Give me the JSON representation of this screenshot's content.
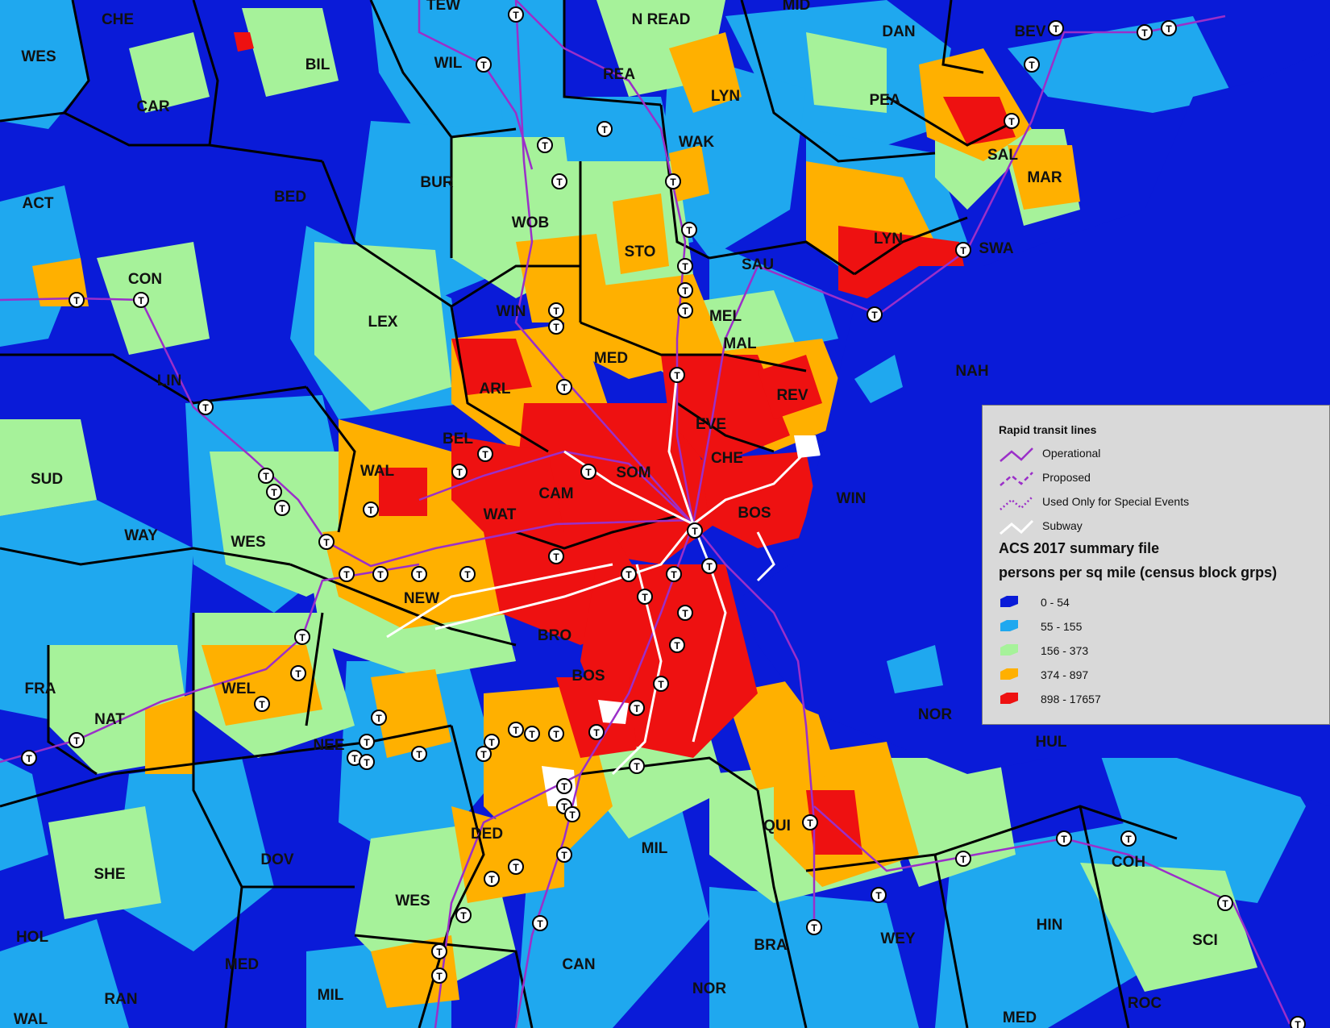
{
  "colors": {
    "class_0_54": "#0a1bd8",
    "class_55_155": "#1fa8ef",
    "class_156_373": "#a6f29a",
    "class_374_897": "#ffb000",
    "class_898_17657": "#ee1111",
    "transit_line": "#9b2fc9",
    "subway": "#ffffff",
    "boundary": "#000000",
    "legend_bg": "#d9d9d9"
  },
  "town_labels": [
    "CHE",
    "TEW",
    "N READ",
    "MID",
    "DAN",
    "BEV",
    "WES",
    "BIL",
    "WIL",
    "REA",
    "LYN",
    "CAR",
    "PEA",
    "WAK",
    "SAL",
    "BUR",
    "BED",
    "MAR",
    "WOB",
    "ACT",
    "STO",
    "LYN",
    "SWA",
    "CON",
    "SAU",
    "WIN",
    "LEX",
    "MEL",
    "MAL",
    "MED",
    "ARL",
    "REV",
    "NAH",
    "LIN",
    "EVE",
    "BEL",
    "CHE",
    "SOM",
    "WAL",
    "SUD",
    "CAM",
    "BOS",
    "WIN",
    "WAT",
    "WAY",
    "WES",
    "NEW",
    "BRO",
    "BOS",
    "FRA",
    "WEL",
    "NAT",
    "NEE",
    "QUI",
    "DED",
    "MIL",
    "SHE",
    "DOV",
    "COH",
    "WES",
    "HIN",
    "SCI",
    "HOL",
    "MED",
    "WEY",
    "BRA",
    "CAN",
    "NOR",
    "RAN",
    "MIL",
    "WAL",
    "MED",
    "ROC",
    "NOR",
    "HUL",
    "HU"
  ],
  "legend": {
    "lines_title": "Rapid transit lines",
    "lines": [
      {
        "label": "Operational",
        "style": "solid",
        "color": "#9b2fc9"
      },
      {
        "label": "Proposed",
        "style": "dashed",
        "color": "#9b2fc9"
      },
      {
        "label": "Used Only for Special Events",
        "style": "dotted",
        "color": "#9b2fc9"
      },
      {
        "label": "Subway",
        "style": "solid",
        "color": "#ffffff"
      }
    ],
    "heading_1": "ACS 2017 summary file",
    "heading_2": "persons per sq mile (census block grps)",
    "classes": [
      {
        "label": "0 - 54",
        "color": "#0a1bd8"
      },
      {
        "label": "55 - 155",
        "color": "#1fa8ef"
      },
      {
        "label": "156 - 373",
        "color": "#a6f29a"
      },
      {
        "label": "374 - 897",
        "color": "#ffb000"
      },
      {
        "label": "898 - 17657",
        "color": "#ee1111"
      }
    ]
  },
  "station_icon": "T"
}
